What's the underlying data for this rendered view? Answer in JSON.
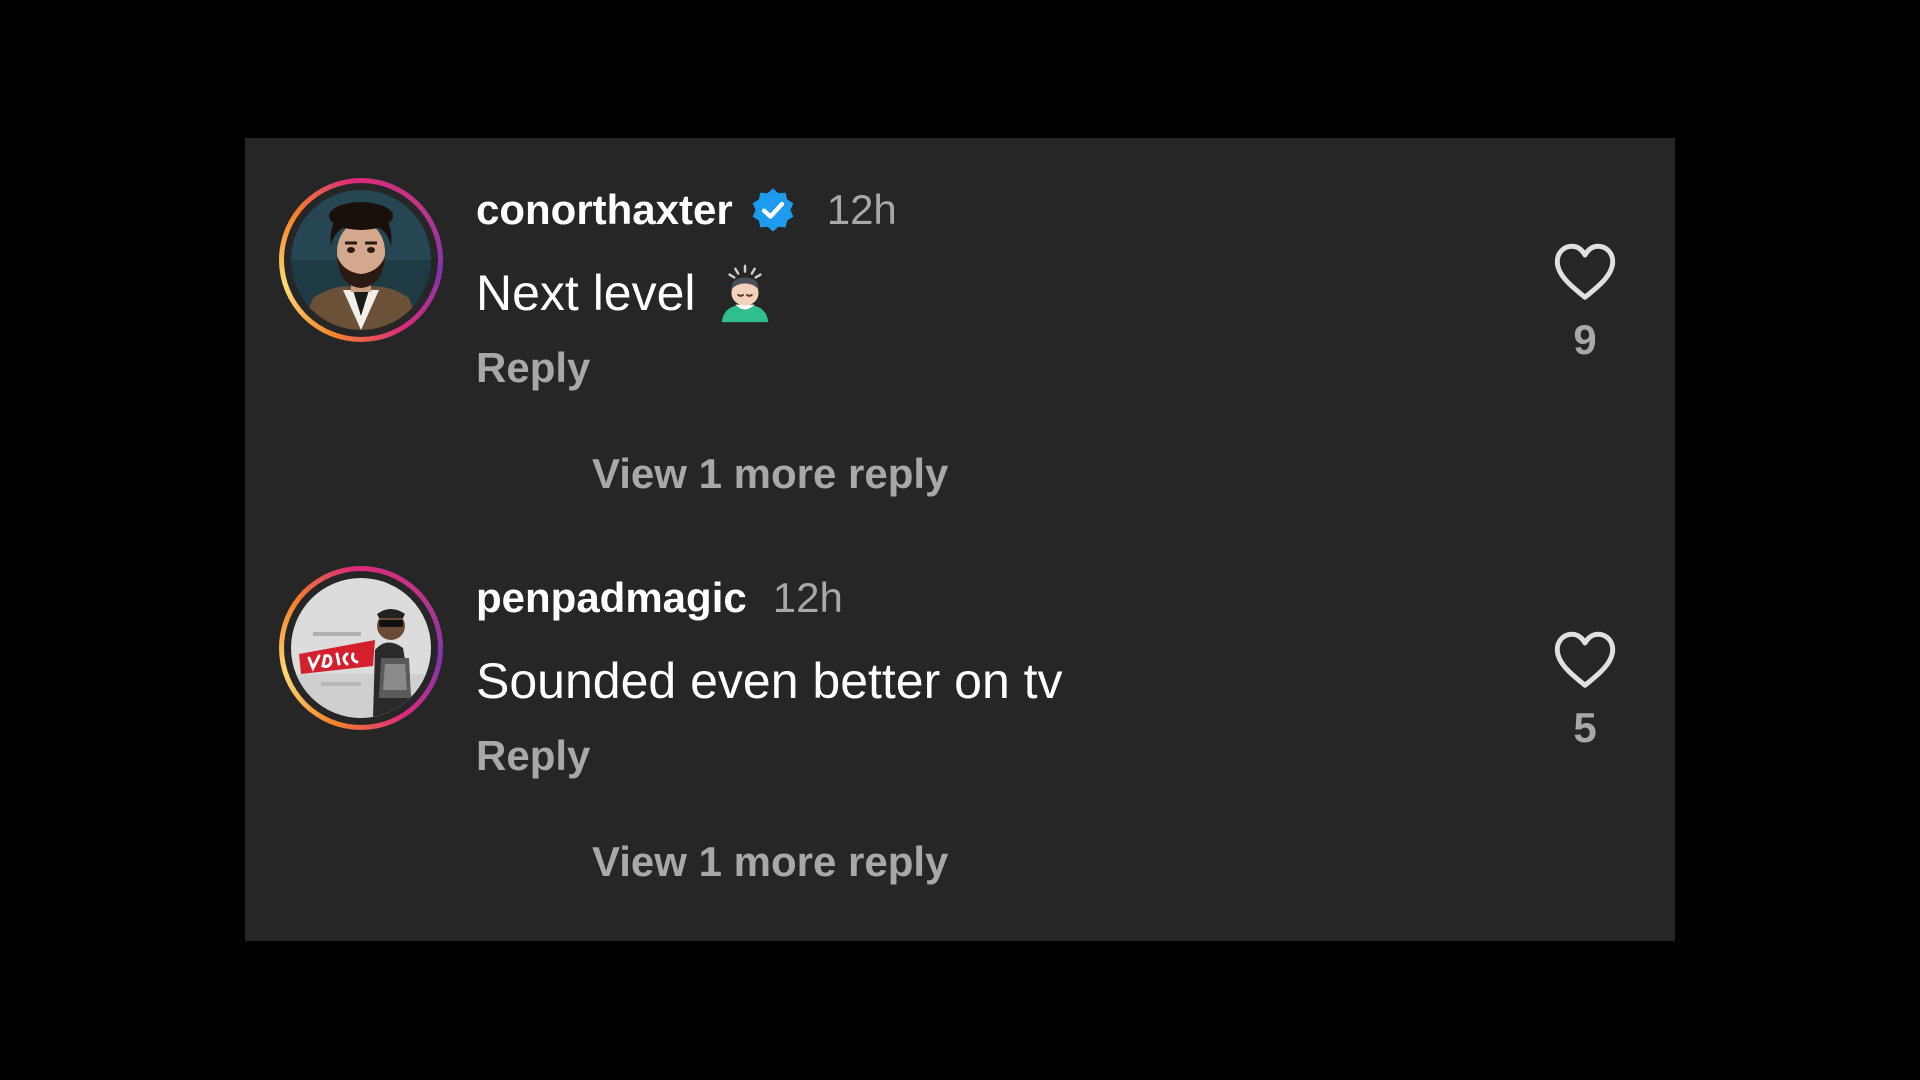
{
  "colors": {
    "background": "#000000",
    "panel": "#262626",
    "primary_text": "#ffffff",
    "secondary_text": "#a8a8a8",
    "verified": "#1d9bf0"
  },
  "comments": [
    {
      "username": "conorthaxter",
      "verified": true,
      "time": "12h",
      "text": "Next level",
      "emoji": "person-bowing-emoji",
      "reply_label": "Reply",
      "view_more_label": "View 1 more reply",
      "likes": "9",
      "like_icon": "heart-outline-icon"
    },
    {
      "username": "penpadmagic",
      "verified": false,
      "time": "12h",
      "text": "Sounded even better on tv",
      "reply_label": "Reply",
      "view_more_label": "View 1 more reply",
      "likes": "5",
      "like_icon": "heart-outline-icon"
    }
  ]
}
